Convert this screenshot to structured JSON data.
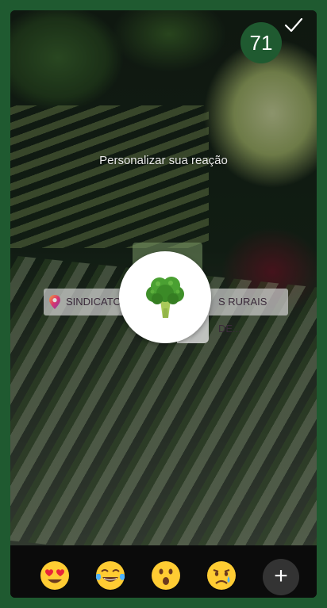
{
  "header": {
    "badge_number": "71",
    "confirm_icon": "checkmark-icon"
  },
  "prompt": {
    "text": "Personalizar sua reação"
  },
  "location_sticker": {
    "left_text": "SINDICATO",
    "right_text": "S RURAIS DE...",
    "icon": "location-pin-icon"
  },
  "reaction": {
    "emoji": "broccoli"
  },
  "emoji_tray": {
    "items": [
      {
        "name": "heart-eyes-emoji"
      },
      {
        "name": "tears-of-joy-emoji"
      },
      {
        "name": "surprised-emoji"
      },
      {
        "name": "crying-emoji"
      }
    ],
    "add_label": "+"
  },
  "colors": {
    "frame": "#1f5a30",
    "tray": "#0b0b0b",
    "reaction_circle": "#ffffff"
  }
}
